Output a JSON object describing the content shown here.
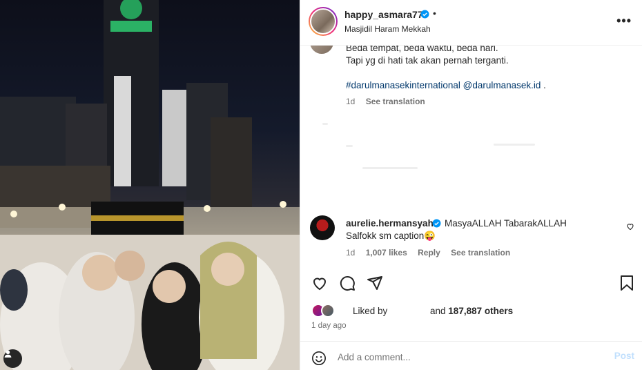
{
  "post": {
    "username": "happy_asmara77",
    "separator": "•",
    "location": "Masjidil Haram Mekkah",
    "more_icon": "more-horizontal-icon"
  },
  "caption": {
    "line1": "Beda tempat, beda waktu, beda hari.",
    "line2": "Tapi yg di hati tak akan pernah terganti.",
    "hashtag": "#darulmanasekinternational",
    "mention": "@darulmanasek.id",
    "trailing": ".",
    "time": "1d",
    "see_translation": "See translation"
  },
  "comment": {
    "username": "aurelie.hermansyah",
    "text_line1": "MasyaALLAH TabarakALLAH",
    "text_line2": "Salfokk sm caption",
    "emoji": "😜",
    "time": "1d",
    "likes": "1,007 likes",
    "reply": "Reply",
    "see_translation": "See translation"
  },
  "likes": {
    "liked_by": "Liked by",
    "and_text": "and",
    "others": "187,887 others"
  },
  "post_time": "1 day ago",
  "add_comment": {
    "placeholder": "Add a comment...",
    "post_label": "Post"
  },
  "colors": {
    "verified": "#0095f6",
    "link": "#00376b",
    "muted": "#737373",
    "post_disabled": "#c0dffd"
  }
}
